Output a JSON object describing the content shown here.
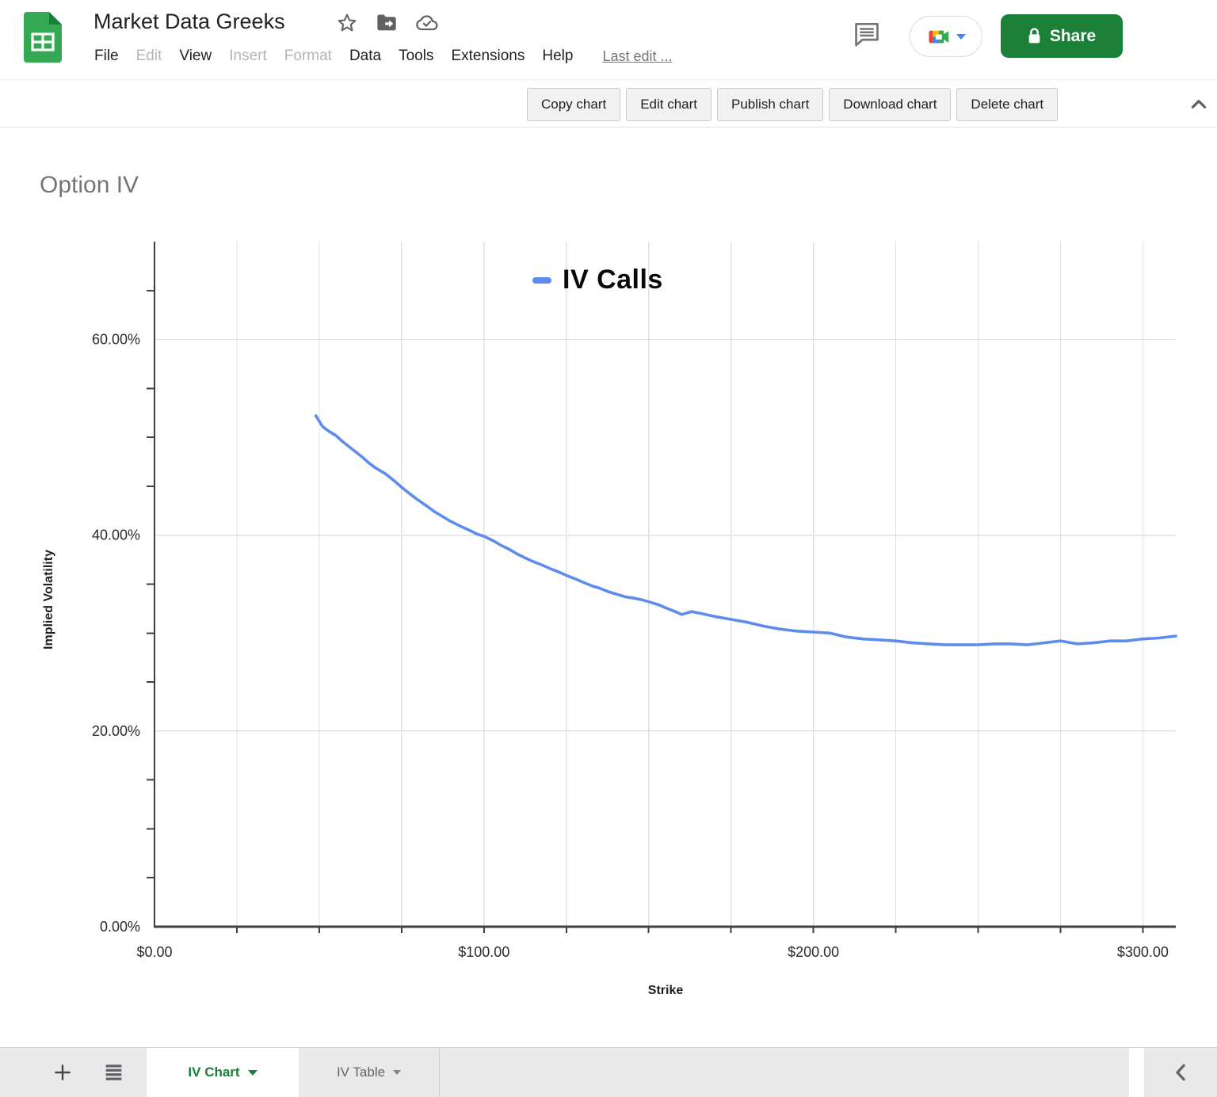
{
  "header": {
    "doc_title": "Market Data Greeks",
    "menu_items": [
      {
        "label": "File",
        "enabled": true
      },
      {
        "label": "Edit",
        "enabled": false
      },
      {
        "label": "View",
        "enabled": true
      },
      {
        "label": "Insert",
        "enabled": false
      },
      {
        "label": "Format",
        "enabled": false
      },
      {
        "label": "Data",
        "enabled": true
      },
      {
        "label": "Tools",
        "enabled": true
      },
      {
        "label": "Extensions",
        "enabled": true
      },
      {
        "label": "Help",
        "enabled": true
      }
    ],
    "last_edit_label": "Last edit ...",
    "share_label": "Share"
  },
  "chart_toolbar": {
    "buttons": [
      "Copy chart",
      "Edit chart",
      "Publish chart",
      "Download chart",
      "Delete chart"
    ]
  },
  "chart_data": {
    "type": "line",
    "title": "Option IV",
    "xlabel": "Strike",
    "ylabel": "Implied Volatility",
    "legend_position": "top-center",
    "grid": true,
    "xlim": [
      0,
      310
    ],
    "ylim": [
      0,
      70
    ],
    "x_major_ticks": [
      {
        "value": 0,
        "label": "$0.00"
      },
      {
        "value": 100,
        "label": "$100.00"
      },
      {
        "value": 200,
        "label": "$200.00"
      },
      {
        "value": 300,
        "label": "$300.00"
      }
    ],
    "x_minor_tick_step": 25,
    "y_major_ticks": [
      {
        "value": 0,
        "label": "0.00%"
      },
      {
        "value": 20,
        "label": "20.00%"
      },
      {
        "value": 40,
        "label": "40.00%"
      },
      {
        "value": 60,
        "label": "60.00%"
      }
    ],
    "y_minor_tick_step": 5,
    "colors": {
      "series_blue": "#5e8cec",
      "gridline": "#e2e2e2",
      "axis": "#3c4043"
    },
    "series": [
      {
        "name": "IV Calls",
        "color": "#5e8cec",
        "points": [
          [
            49,
            52.2
          ],
          [
            51,
            51.1
          ],
          [
            53,
            50.6
          ],
          [
            55,
            50.2
          ],
          [
            57,
            49.6
          ],
          [
            60,
            48.8
          ],
          [
            63,
            48.0
          ],
          [
            65,
            47.4
          ],
          [
            67,
            46.9
          ],
          [
            70,
            46.3
          ],
          [
            73,
            45.5
          ],
          [
            75,
            44.9
          ],
          [
            78,
            44.1
          ],
          [
            80,
            43.6
          ],
          [
            83,
            42.9
          ],
          [
            85,
            42.4
          ],
          [
            88,
            41.8
          ],
          [
            90,
            41.4
          ],
          [
            93,
            40.9
          ],
          [
            95,
            40.6
          ],
          [
            98,
            40.1
          ],
          [
            100,
            39.9
          ],
          [
            103,
            39.4
          ],
          [
            105,
            39.0
          ],
          [
            108,
            38.5
          ],
          [
            110,
            38.1
          ],
          [
            113,
            37.6
          ],
          [
            115,
            37.3
          ],
          [
            118,
            36.9
          ],
          [
            120,
            36.6
          ],
          [
            123,
            36.2
          ],
          [
            125,
            35.9
          ],
          [
            128,
            35.5
          ],
          [
            130,
            35.2
          ],
          [
            133,
            34.8
          ],
          [
            135,
            34.6
          ],
          [
            138,
            34.2
          ],
          [
            140,
            34.0
          ],
          [
            143,
            33.7
          ],
          [
            145,
            33.6
          ],
          [
            148,
            33.4
          ],
          [
            150,
            33.2
          ],
          [
            153,
            32.9
          ],
          [
            155,
            32.6
          ],
          [
            158,
            32.2
          ],
          [
            160,
            31.9
          ],
          [
            163,
            32.2
          ],
          [
            166,
            32.0
          ],
          [
            170,
            31.7
          ],
          [
            175,
            31.4
          ],
          [
            180,
            31.1
          ],
          [
            185,
            30.7
          ],
          [
            190,
            30.4
          ],
          [
            195,
            30.2
          ],
          [
            200,
            30.1
          ],
          [
            205,
            30.0
          ],
          [
            210,
            29.6
          ],
          [
            215,
            29.4
          ],
          [
            220,
            29.3
          ],
          [
            225,
            29.2
          ],
          [
            230,
            29.0
          ],
          [
            235,
            28.9
          ],
          [
            240,
            28.8
          ],
          [
            245,
            28.8
          ],
          [
            250,
            28.8
          ],
          [
            255,
            28.9
          ],
          [
            260,
            28.9
          ],
          [
            265,
            28.8
          ],
          [
            270,
            29.0
          ],
          [
            275,
            29.2
          ],
          [
            280,
            28.9
          ],
          [
            285,
            29.0
          ],
          [
            290,
            29.2
          ],
          [
            295,
            29.2
          ],
          [
            300,
            29.4
          ],
          [
            305,
            29.5
          ],
          [
            310,
            29.7
          ]
        ]
      }
    ]
  },
  "bottom_bar": {
    "tabs": [
      {
        "label": "IV Chart",
        "active": true
      },
      {
        "label": "IV Table",
        "active": false
      }
    ]
  }
}
